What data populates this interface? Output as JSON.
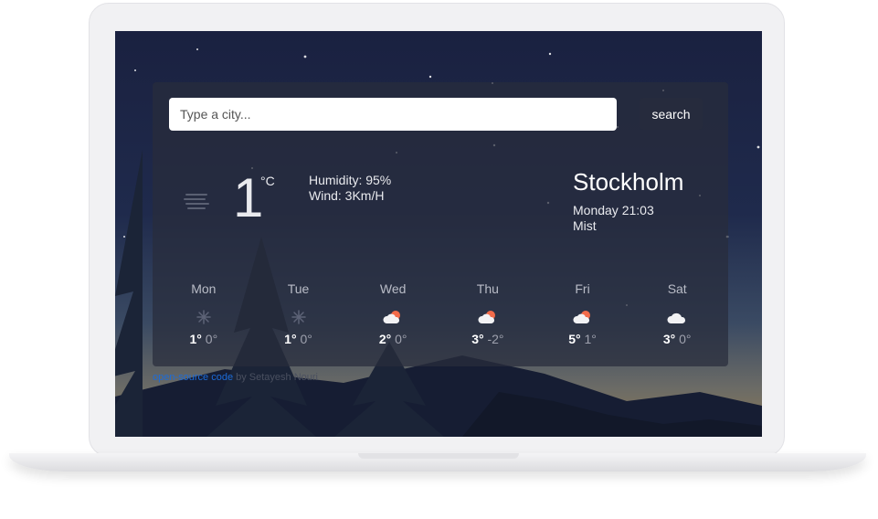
{
  "search": {
    "placeholder": "Type a city...",
    "button_label": "search"
  },
  "current": {
    "temperature": "1",
    "unit": "°C",
    "humidity": "Humidity: 95%",
    "wind": "Wind: 3Km/H",
    "icon": "mist-icon",
    "city": "Stockholm",
    "datetime": "Monday 21:03",
    "condition": "Mist"
  },
  "forecast": [
    {
      "day": "Mon",
      "max": "1°",
      "min": "0°",
      "icon": "snow-icon"
    },
    {
      "day": "Tue",
      "max": "1°",
      "min": "0°",
      "icon": "snow-icon"
    },
    {
      "day": "Wed",
      "max": "2°",
      "min": "0°",
      "icon": "partly-cloudy-icon"
    },
    {
      "day": "Thu",
      "max": "3°",
      "min": "-2°",
      "icon": "partly-cloudy-icon"
    },
    {
      "day": "Fri",
      "max": "5°",
      "min": "1°",
      "icon": "partly-cloudy-icon"
    },
    {
      "day": "Sat",
      "max": "3°",
      "min": "0°",
      "icon": "cloud-icon"
    }
  ],
  "footer": {
    "link_text": "open-source code",
    "suffix_text": " by Setayesh Nouri"
  },
  "colors": {
    "link": "#1c6bd8",
    "card": "#282d3c",
    "sky": "#1f2a4c"
  }
}
